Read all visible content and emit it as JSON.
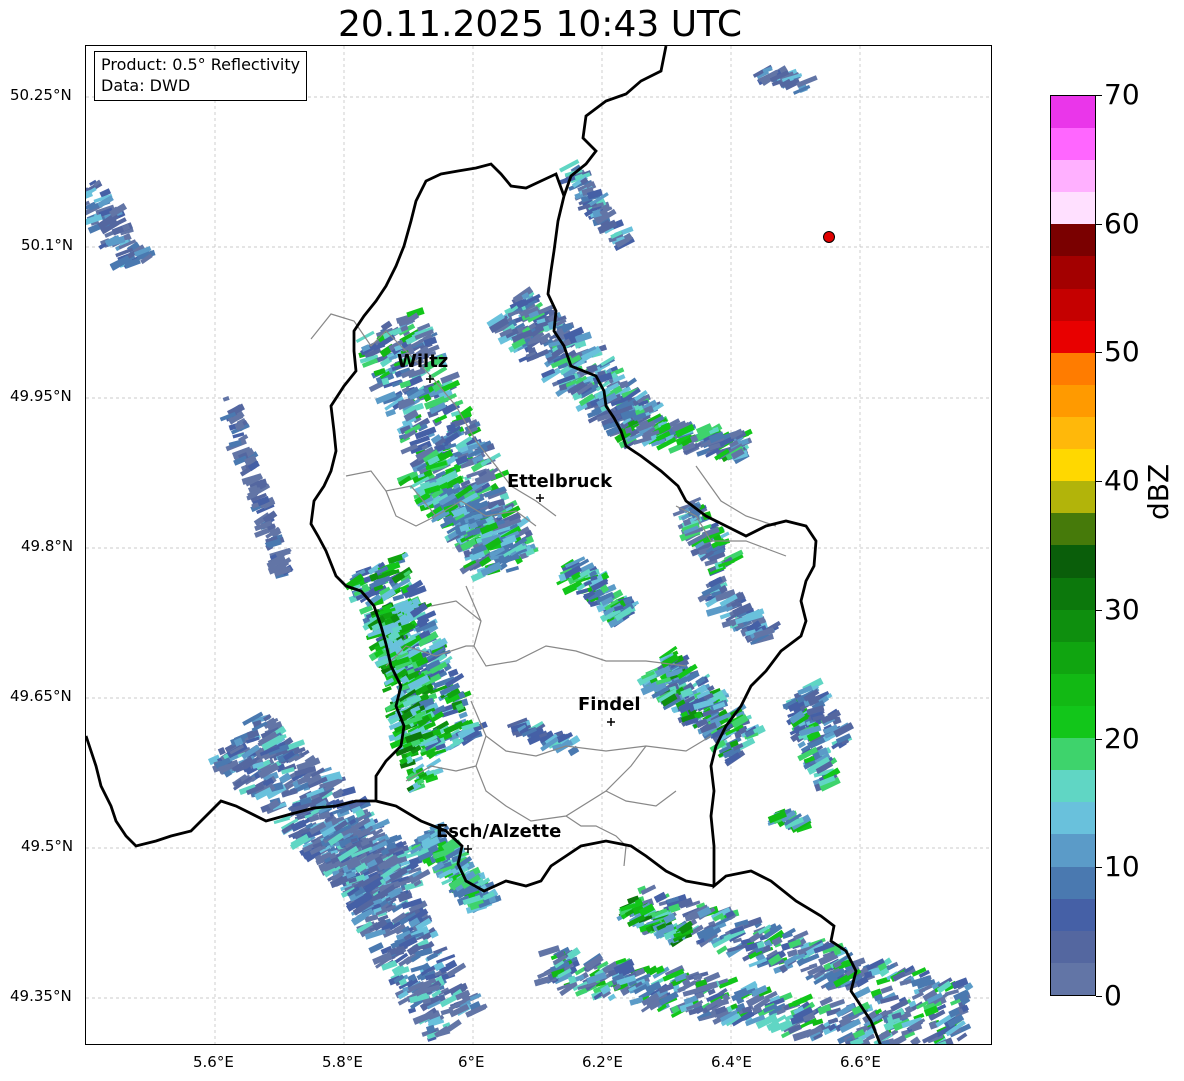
{
  "title": "20.11.2025 10:43 UTC",
  "info": {
    "product": "Product: 0.5° Reflectivity",
    "source": "Data: DWD"
  },
  "lat_labels": [
    "50.25°N",
    "50.1°N",
    "49.95°N",
    "49.8°N",
    "49.65°N",
    "49.5°N",
    "49.35°N"
  ],
  "lon_labels": [
    "5.6°E",
    "5.8°E",
    "6°E",
    "6.2°E",
    "6.4°E",
    "6.6°E"
  ],
  "cities": [
    {
      "name": "Wiltz"
    },
    {
      "name": "Ettelbruck"
    },
    {
      "name": "Findel"
    },
    {
      "name": "Esch/Alzette"
    }
  ],
  "colorbar": {
    "label": "dBZ",
    "ticks": [
      "0",
      "10",
      "20",
      "30",
      "40",
      "50",
      "60",
      "70"
    ],
    "colors": [
      "#6275a6",
      "#5467a0",
      "#4560a6",
      "#4a79b0",
      "#5b9bc8",
      "#69c1dc",
      "#60d6c4",
      "#3ed36c",
      "#12c61a",
      "#12b914",
      "#10a510",
      "#0e8f0e",
      "#0c780c",
      "#0a5e0a",
      "#467a0a",
      "#b2b40a",
      "#ffd800",
      "#ffb80a",
      "#ff9a00",
      "#ff7c00",
      "#e80000",
      "#c50000",
      "#a30000",
      "#7a0000",
      "#ffe0ff",
      "#ffb0ff",
      "#ff66ff",
      "#ea36ea"
    ]
  },
  "map_colors": {
    "border": "#000000",
    "cantons": "#888888",
    "grid": "#bbbbbb",
    "radar_site": "#e00000"
  }
}
